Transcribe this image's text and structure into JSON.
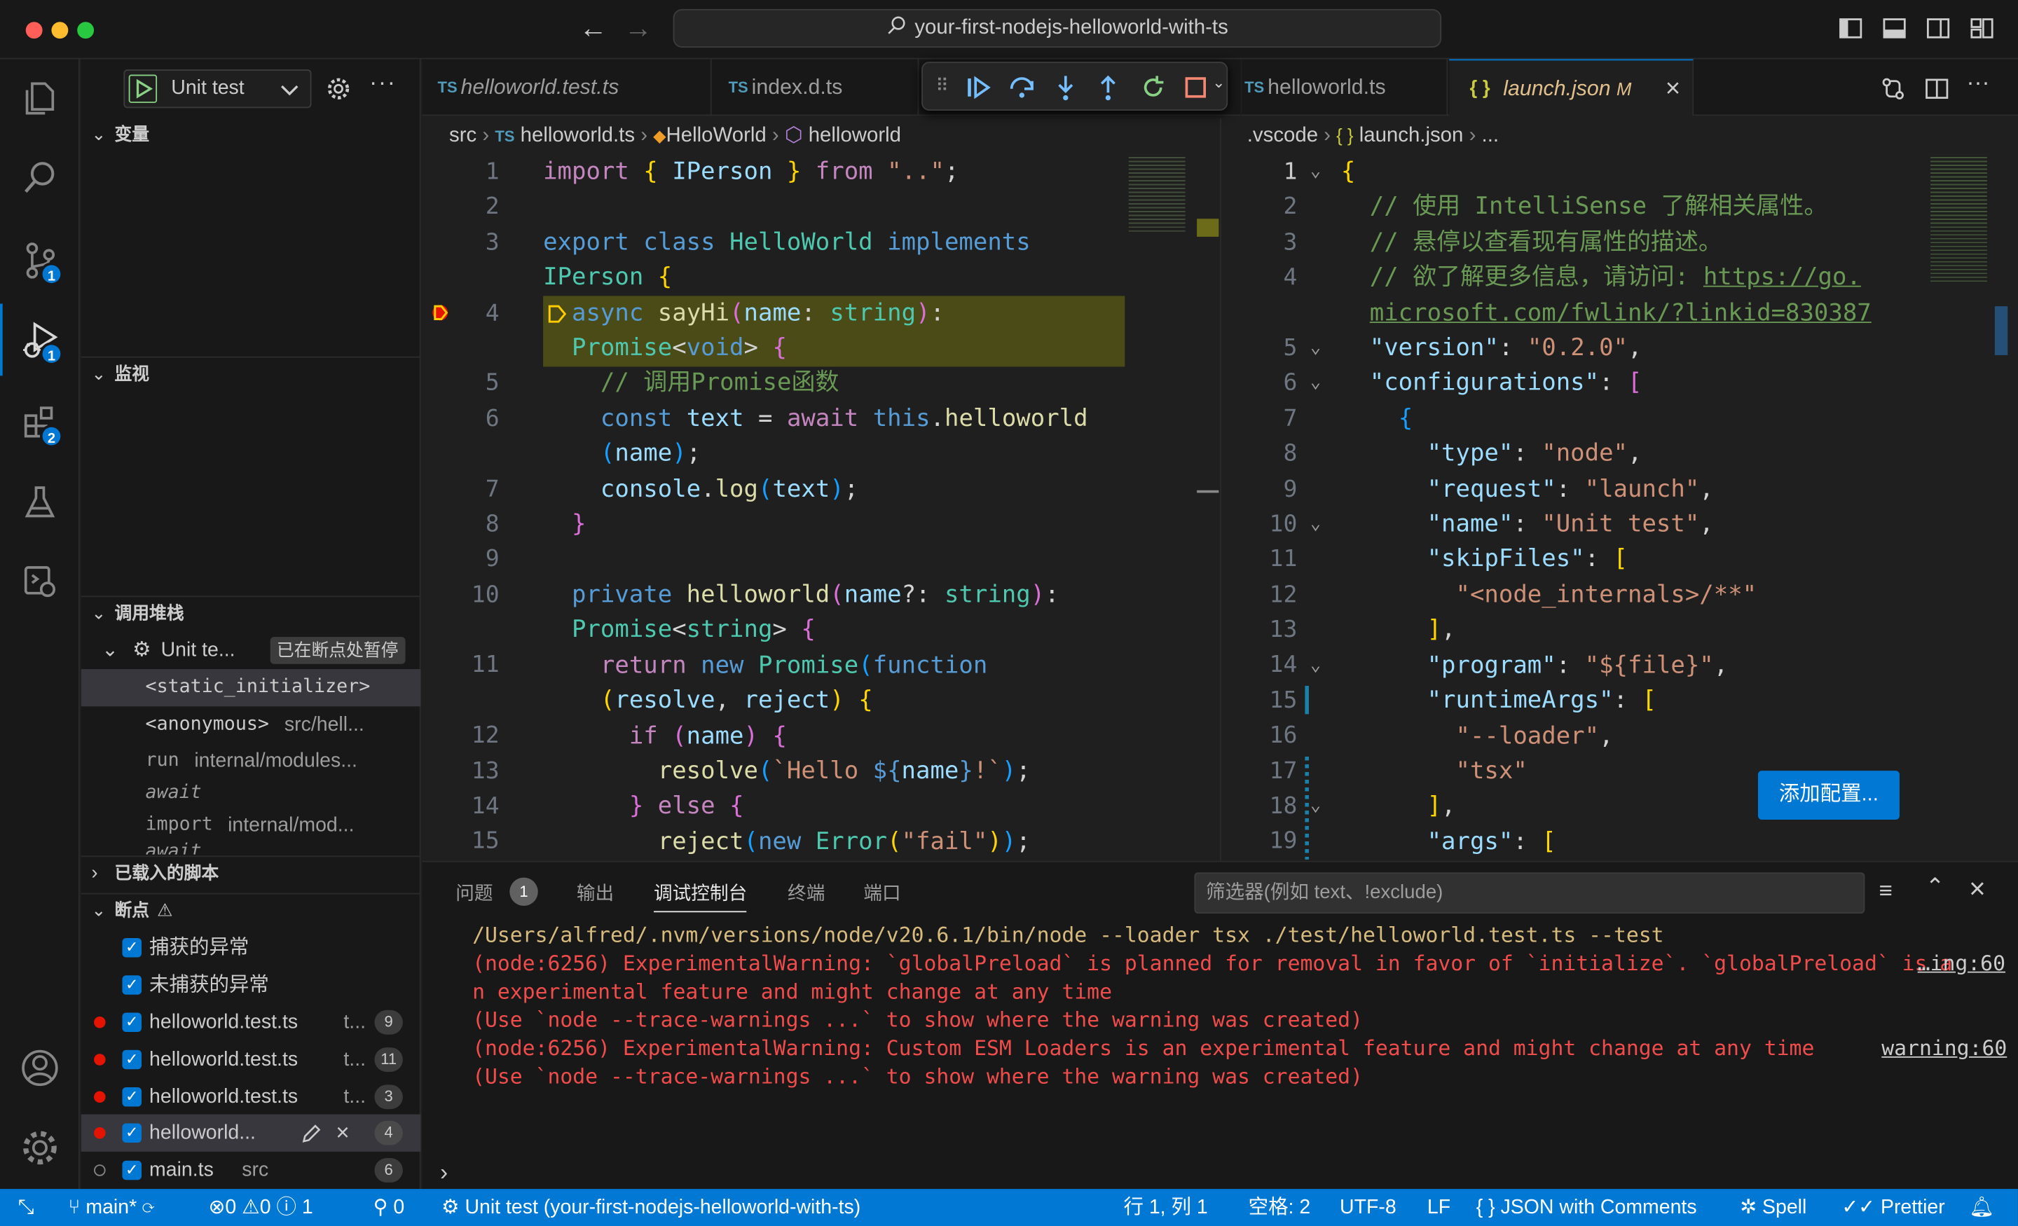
{
  "window": {
    "search_text": "your-first-nodejs-helloworld-with-ts"
  },
  "activity_bar": {
    "scm_badge": "1",
    "debug_badge": "1",
    "extensions_badge": "2"
  },
  "debug": {
    "config": "Unit test"
  },
  "sidebar": {
    "variables": "变量",
    "watch": "监视",
    "callstack": {
      "title": "调用堆栈",
      "session": "Unit te...",
      "paused": "已在断点处暂停",
      "frames": [
        {
          "name": "<static_initializer>",
          "src": ""
        },
        {
          "name": "<anonymous>",
          "src": "src/hell..."
        },
        {
          "name": "run",
          "src": "internal/modules..."
        },
        {
          "name": "await",
          "src": ""
        },
        {
          "name": "import",
          "src": "internal/mod..."
        },
        {
          "name": "await",
          "src": ""
        }
      ]
    },
    "loaded_scripts": "已载入的脚本",
    "breakpoints": {
      "title": "断点",
      "caught": "捕获的异常",
      "uncaught": "未捕获的异常",
      "items": [
        {
          "file": "helloworld.test.ts",
          "dir": "t...",
          "line": "9"
        },
        {
          "file": "helloworld.test.ts",
          "dir": "t...",
          "line": "11"
        },
        {
          "file": "helloworld.test.ts",
          "dir": "t...",
          "line": "3"
        },
        {
          "file": "helloworld...",
          "dir": "",
          "line": "4"
        },
        {
          "file": "main.ts",
          "dir": "src",
          "line": "6"
        }
      ]
    }
  },
  "tabs_left": [
    {
      "label": "helloworld.test.ts",
      "icon": "TS"
    },
    {
      "label": "index.d.ts",
      "icon": "TS"
    }
  ],
  "tabs_right": [
    {
      "label": "helloworld.ts",
      "icon": "TS"
    },
    {
      "label": "launch.json",
      "icon": "{ }",
      "modified": "M"
    }
  ],
  "breadcrumb_left": [
    "src",
    "helloworld.ts",
    "HelloWorld",
    "helloworld"
  ],
  "breadcrumb_right": [
    ".vscode",
    "launch.json",
    "..."
  ],
  "editor_left": {
    "line_numbers": [
      "1",
      "2",
      "3",
      "",
      "4",
      "",
      "5",
      "6",
      "",
      "7",
      "8",
      "9",
      "10",
      "",
      "11",
      "",
      "12",
      "13",
      "14",
      "15"
    ]
  },
  "editor_right": {
    "line_numbers": [
      "1",
      "2",
      "3",
      "4",
      "",
      "5",
      "6",
      "7",
      "8",
      "9",
      "10",
      "11",
      "12",
      "13",
      "14",
      "15",
      "16",
      "17",
      "18",
      "19"
    ],
    "add_config": "添加配置..."
  },
  "panel": {
    "tabs": [
      "问题",
      "输出",
      "调试控制台",
      "终端",
      "端口"
    ],
    "problems_count": "1",
    "filter_placeholder": "筛选器(例如 text、!exclude)",
    "output": [
      "/Users/alfred/.nvm/versions/node/v20.6.1/bin/node --loader tsx ./test/helloworld.test.ts --test",
      "(node:6256) ExperimentalWarning: `globalPreload` is planned for removal in favor of `initialize`. `globalPreload` is a",
      "n experimental feature and might change at any time",
      "(Use `node --trace-warnings ...` to show where the warning was created)",
      "(node:6256) ExperimentalWarning: Custom ESM Loaders is an experimental feature and might change at any time",
      "(Use `node --trace-warnings ...` to show where the warning was created)"
    ],
    "link1": "…ing:60",
    "link2": "warning:60"
  },
  "status": {
    "branch": "main*",
    "errors": "0",
    "warnings": "0",
    "infos": "1",
    "ports": "0",
    "debug_session": "Unit test (your-first-nodejs-helloworld-with-ts)",
    "position": "行 1, 列 1",
    "spaces": "空格: 2",
    "encoding": "UTF-8",
    "eol": "LF",
    "language": "JSON with Comments",
    "spell": "Spell",
    "prettier": "Prettier"
  },
  "colors": {
    "accent": "#0078d4",
    "breakpoint": "#e51400",
    "highlight": "#4b4b18"
  }
}
